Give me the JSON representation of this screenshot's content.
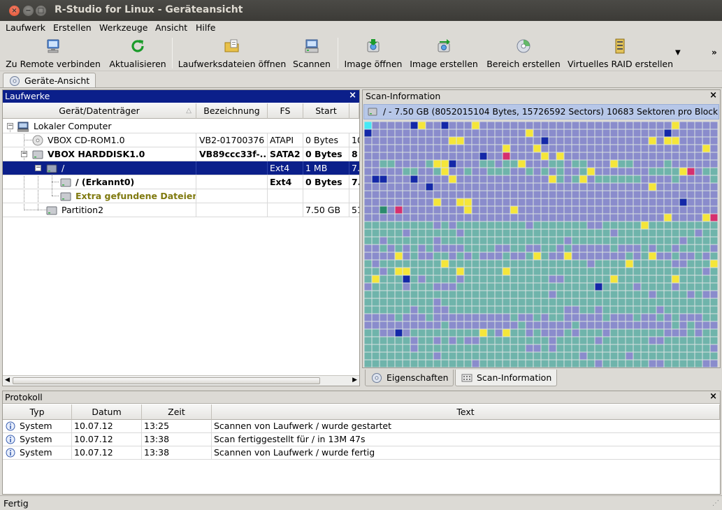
{
  "window": {
    "title": "R-Studio for Linux - Geräteansicht",
    "close_glyph": "×",
    "minimize_glyph": "−",
    "maximize_glyph": "□"
  },
  "menu": [
    "Laufwerk",
    "Erstellen",
    "Werkzeuge",
    "Ansicht",
    "Hilfe"
  ],
  "toolbar": {
    "connect_remote": "Zu Remote verbinden",
    "refresh": "Aktualisieren",
    "open_drive_files": "Laufwerksdateien öffnen",
    "scan": "Scannen",
    "open_image": "Image öffnen",
    "create_image": "Image erstellen",
    "create_region": "Bereich erstellen",
    "create_virtual_raid": "Virtuelles RAID erstellen",
    "more_glyph": "▼",
    "overflow_glyph": "»"
  },
  "doc_tab": {
    "label": "Geräte-Ansicht"
  },
  "drives_panel": {
    "title": "Laufwerke",
    "close_glyph": "×",
    "columns": [
      "Gerät/Datenträger",
      "Bezeichnung",
      "FS",
      "Start",
      ""
    ],
    "sort_glyph": "△",
    "rows": [
      {
        "device": "Lokaler Computer",
        "label": "",
        "fs": "",
        "start": "",
        "extra": ""
      },
      {
        "device": "VBOX CD-ROM1.0",
        "label": "VB2-01700376",
        "fs": "ATAPI",
        "start": "0 Bytes",
        "extra": "10"
      },
      {
        "device": "VBOX HARDDISK1.0",
        "label": "VB89ccc33f-...",
        "fs": "SATA2",
        "start": "0 Bytes",
        "extra": "8"
      },
      {
        "device": "/",
        "label": "",
        "fs": "Ext4",
        "start": "1 MB",
        "extra": "7."
      },
      {
        "device": "/ (Erkannt0)",
        "label": "",
        "fs": "Ext4",
        "start": "0 Bytes",
        "extra": "7."
      },
      {
        "device": "Extra gefundene Dateien",
        "label": "",
        "fs": "",
        "start": "",
        "extra": ""
      },
      {
        "device": "Partition2",
        "label": "",
        "fs": "",
        "start": "7.50 GB",
        "extra": "51"
      }
    ],
    "tree_collapse_glyph": "−",
    "scroll_left_glyph": "◀",
    "scroll_right_glyph": "▶"
  },
  "scan_panel": {
    "title": "Scan-Information",
    "close_glyph": "×",
    "info": "/ - 7.50 GB (8052015104 Bytes, 15726592 Sectors) 10683 Sektoren pro Block",
    "colors": {
      "empty": "#6fb4ab",
      "used": "#8a8ccc",
      "yellow": "#f5e63a",
      "blue": "#1428a8",
      "pink": "#d6306e",
      "teal": "#2c8a6e",
      "cyan": "#45e8f5"
    }
  },
  "right_tabs": [
    "Eigenschaften",
    "Scan-Information"
  ],
  "log_panel": {
    "title": "Protokoll",
    "close_glyph": "×",
    "columns": [
      "Typ",
      "Datum",
      "Zeit",
      "Text"
    ],
    "rows": [
      {
        "type": "System",
        "date": "10.07.12",
        "time": "13:25",
        "text": "Scannen von Laufwerk / wurde gestartet"
      },
      {
        "type": "System",
        "date": "10.07.12",
        "time": "13:38",
        "text": "Scan fertiggestellt für / in 13M 47s"
      },
      {
        "type": "System",
        "date": "10.07.12",
        "time": "13:38",
        "text": "Scannen von Laufwerk / wurde fertig"
      }
    ]
  },
  "status": {
    "text": "Fertig",
    "grip_glyph": "⋰"
  }
}
